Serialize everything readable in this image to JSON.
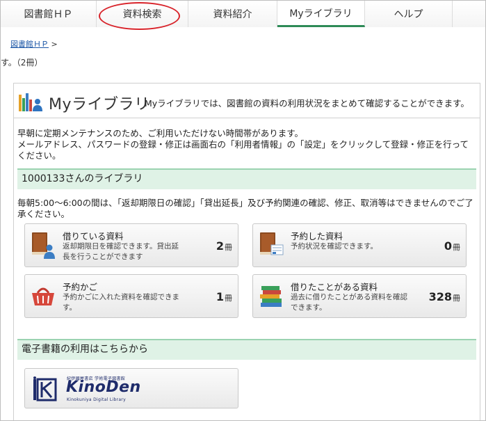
{
  "nav": {
    "tabs": [
      {
        "label": "図書館ＨＰ"
      },
      {
        "label": "資料検索"
      },
      {
        "label": "資料紹介"
      },
      {
        "label": "Myライブラリ"
      },
      {
        "label": "ヘルプ"
      }
    ],
    "active_index": 3
  },
  "breadcrumb": {
    "home": "図書館ＨＰ",
    "separator": ">"
  },
  "left_cut_text": "す。（2冊）",
  "panel": {
    "title": "Myライブラリ",
    "description": "Myライブラリでは、図書館の資料の利用状況をまとめて確認することができます。"
  },
  "notice": {
    "line1": "早朝に定期メンテナンスのため、ご利用いただけない時間帯があります。",
    "line2": "メールアドレス、パスワードの登録・修正は画面右の「利用者情報」の「設定」をクリックして登録・修正を行ってください。"
  },
  "library_section": {
    "title": "1000133さんのライブラリ",
    "maintenance": "毎朝5:00～6:00の間は、「返却期限日の確認」「貸出延長」及び予約関連の確認、修正、取消等はできませんのでご了承ください。"
  },
  "cards": [
    {
      "title": "借りている資料",
      "desc": "返却期限日を確認できます。貸出延長を行うことができます",
      "count": "2",
      "unit": "冊",
      "icon": "borrowed-book-icon"
    },
    {
      "title": "予約した資料",
      "desc": "予約状況を確認できます。",
      "count": "0",
      "unit": "冊",
      "icon": "reserved-book-icon"
    },
    {
      "title": "予約かご",
      "desc": "予約かごに入れた資料を確認できます。",
      "count": "1",
      "unit": "冊",
      "icon": "basket-icon"
    },
    {
      "title": "借りたことがある資料",
      "desc": "過去に借りたことがある資料を確認できます。",
      "count": "328",
      "unit": "冊",
      "icon": "book-stack-icon"
    }
  ],
  "ebook_section": {
    "title": "電子書籍の利用はこちらから"
  },
  "kinoden": {
    "small_text": "紀伊國屋書店 学術電子図書館",
    "name": "KinoDen",
    "sub_text": "Kinokuniya Digital Library"
  },
  "colors": {
    "accent_green": "#2e8b57",
    "section_bg": "#dff2e6",
    "highlight_red": "#d8232a",
    "brand_navy": "#1f2c6b"
  }
}
